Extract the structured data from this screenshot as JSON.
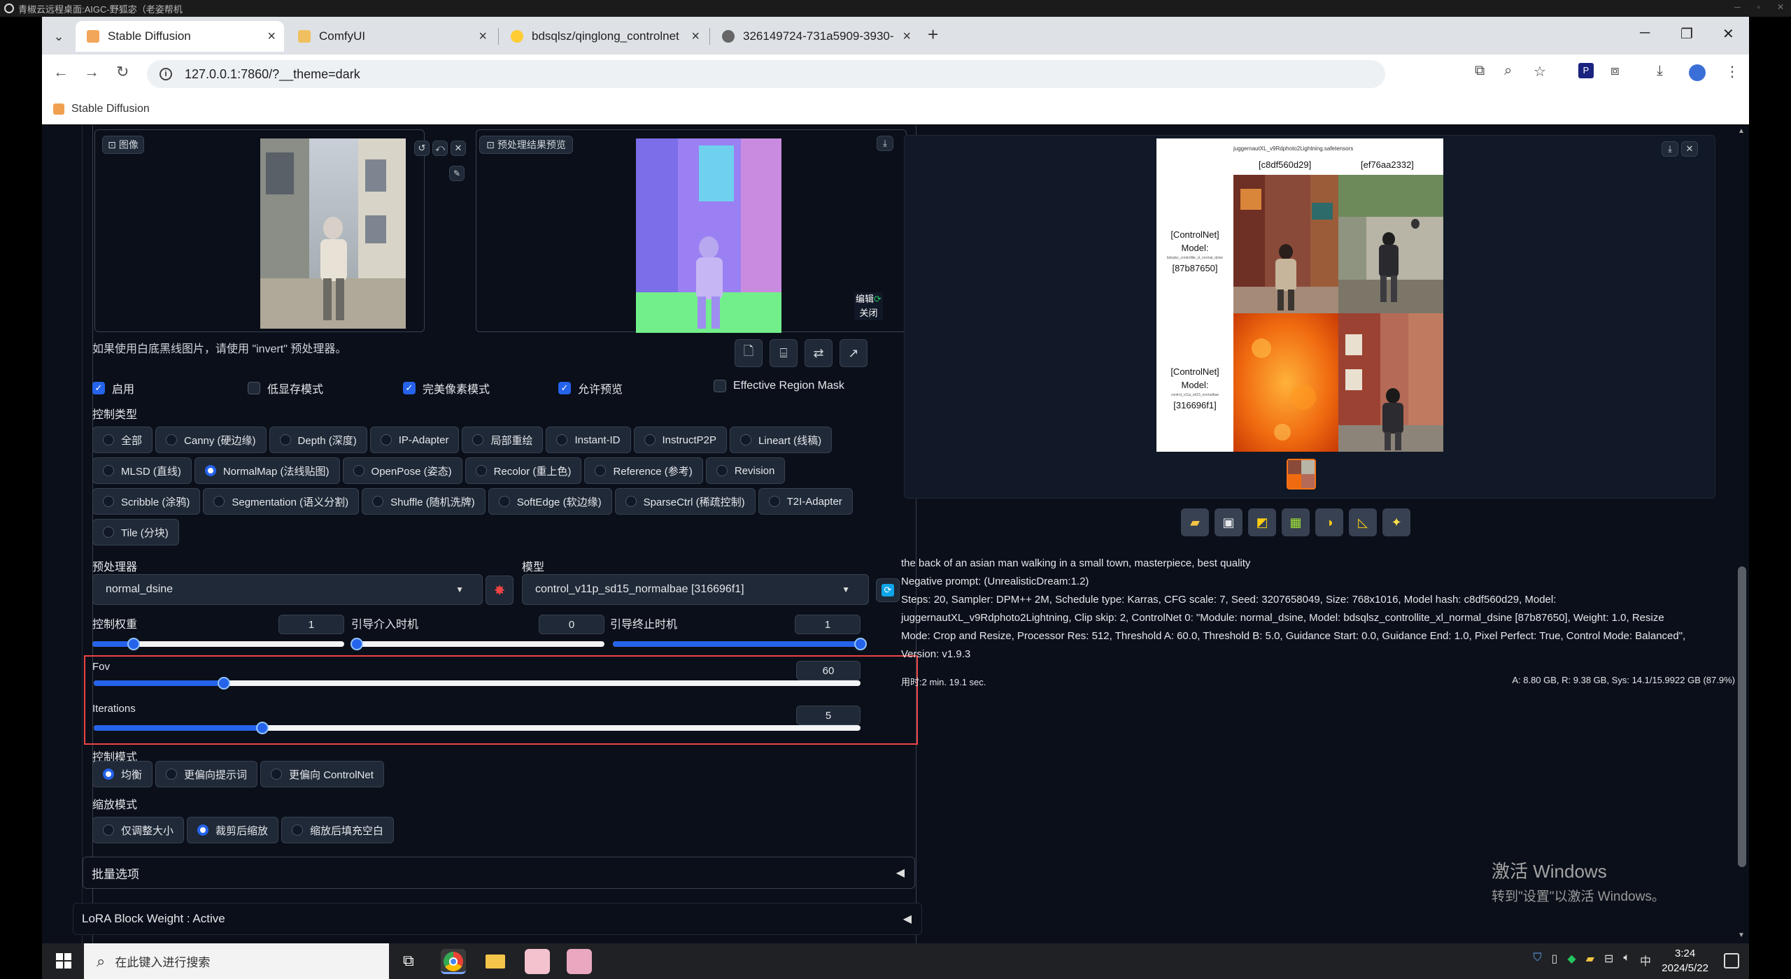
{
  "remote": {
    "title": "青椒云远程桌面:AIGC-野狐宓（老姿帮机"
  },
  "browser": {
    "tabs": [
      {
        "label": "Stable Diffusion",
        "active": true
      },
      {
        "label": "ComfyUI",
        "active": false
      },
      {
        "label": "bdsqlsz/qinglong_controlnet",
        "active": false
      },
      {
        "label": "326149724-731a5909-3930-",
        "active": false
      }
    ],
    "url": "127.0.0.1:7860/?__theme=dark",
    "bookmark": "Stable Diffusion"
  },
  "controlnet": {
    "image_label": "图像",
    "preview_label": "预处理结果预览",
    "edit_label": "编辑",
    "close_label": "关闭",
    "invert_hint": "如果使用白底黑线图片，请使用 \"invert\" 预处理器。",
    "checks": [
      {
        "label": "启用",
        "checked": true
      },
      {
        "label": "低显存模式",
        "checked": false
      },
      {
        "label": "完美像素模式",
        "checked": true
      },
      {
        "label": "允许预览",
        "checked": true
      },
      {
        "label": "Effective Region Mask",
        "checked": false
      }
    ],
    "control_type_label": "控制类型",
    "control_types_row1": [
      "全部",
      "Canny (硬边缘)",
      "Depth (深度)",
      "IP-Adapter",
      "局部重绘",
      "Instant-ID",
      "InstructP2P",
      "Lineart (线稿)"
    ],
    "control_types_row2": [
      "MLSD (直线)",
      "NormalMap (法线贴图)",
      "OpenPose (姿态)",
      "Recolor (重上色)",
      "Reference (参考)",
      "Revision"
    ],
    "control_types_row3": [
      "Scribble (涂鸦)",
      "Segmentation (语义分割)",
      "Shuffle (随机洗牌)",
      "SoftEdge (软边缘)",
      "SparseCtrl (稀疏控制)",
      "T2I-Adapter"
    ],
    "control_types_row4": [
      "Tile (分块)"
    ],
    "selected_type": "NormalMap (法线贴图)",
    "preprocessor_label": "预处理器",
    "preprocessor_value": "normal_dsine",
    "model_label": "模型",
    "model_value": "control_v11p_sd15_normalbae [316696f1]",
    "weight_label": "控制权重",
    "weight_value": "1",
    "start_label": "引导介入时机",
    "start_value": "0",
    "end_label": "引导终止时机",
    "end_value": "1",
    "fov_label": "Fov",
    "fov_value": "60",
    "fov_fraction": 0.17,
    "iter_label": "Iterations",
    "iter_value": "5",
    "iter_fraction": 0.22,
    "weight_fraction": 0.165,
    "start_fraction": 0.0,
    "end_fraction": 1.0,
    "mode_label": "控制模式",
    "modes": [
      "均衡",
      "更偏向提示词",
      "更偏向 ControlNet"
    ],
    "selected_mode": "均衡",
    "resize_label": "缩放模式",
    "resizes": [
      "仅调整大小",
      "裁剪后缩放",
      "缩放后填充空白"
    ],
    "selected_resize": "裁剪后缩放",
    "batch_label": "批量选项",
    "lora_label": "LoRA Block Weight : Active"
  },
  "output": {
    "grid_header_1": "[c8df560d29]",
    "grid_header_2": "[ef76aa2332]",
    "grid_top_caption": "juggernautXL_v9Rdphoto2Lightning.safetensors",
    "row1_label": [
      "[ControlNet]",
      "Model:",
      "[87b87650]"
    ],
    "row2_label": [
      "[ControlNet]",
      "Model:",
      "[316696f1]"
    ],
    "prompt": "the back of an asian man walking in a small town, masterpiece, best quality",
    "negative": "Negative prompt: (UnrealisticDream:1.2)",
    "params_1": "Steps: 20, Sampler: DPM++ 2M, Schedule type: Karras, CFG scale: 7, Seed: 3207658049, Size: 768x1016, Model hash: c8df560d29, Model:",
    "params_2": "juggernautXL_v9Rdphoto2Lightning, Clip skip: 2, ControlNet 0: \"Module: normal_dsine, Model: bdsqlsz_controllite_xl_normal_dsine [87b87650], Weight: 1.0, Resize",
    "params_3": "Mode: Crop and Resize, Processor Res: 512, Threshold A: 60.0, Threshold B: 5.0, Guidance Start: 0.0, Guidance End: 1.0, Pixel Perfect: True, Control Mode: Balanced\",",
    "params_4": "Version: v1.9.3",
    "time": "用时:2 min. 19.1 sec.",
    "vram": "A: 8.80 GB, R: 9.38 GB, Sys: 14.1/15.9922 GB (87.9%)"
  },
  "watermark": {
    "line1": "激活 Windows",
    "line2": "转到\"设置\"以激活 Windows。"
  },
  "taskbar": {
    "search_placeholder": "在此键入进行搜索",
    "time": "3:24",
    "date": "2024/5/22",
    "ime": "中"
  }
}
